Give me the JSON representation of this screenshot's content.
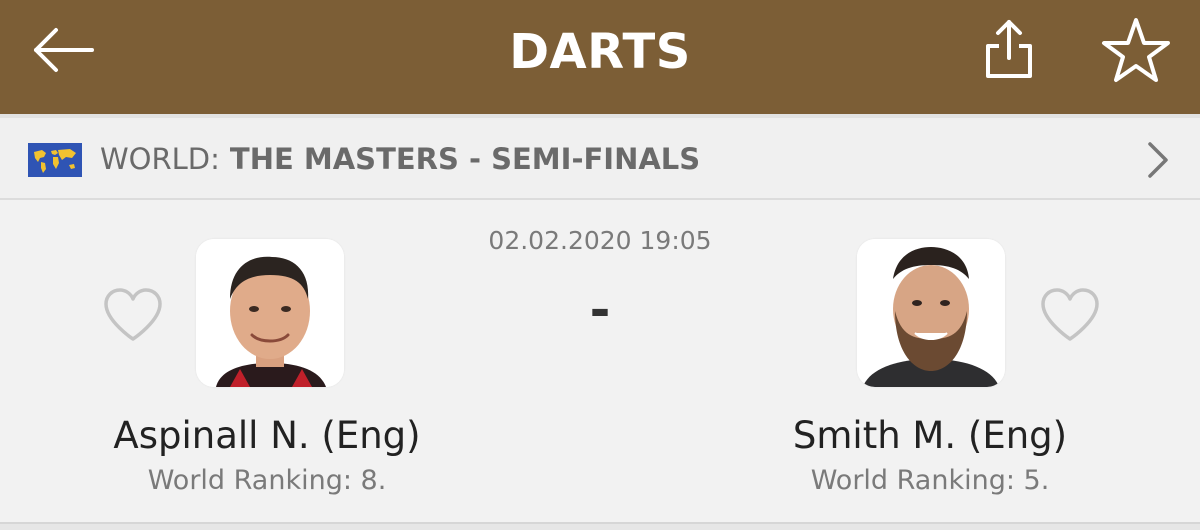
{
  "header": {
    "title": "DARTS",
    "back_icon": "arrow-left-icon",
    "share_icon": "share-icon",
    "favorite_icon": "star-icon",
    "background_color": "#7c5e36"
  },
  "league": {
    "flag_icon": "world-map-flag-icon",
    "country": "WORLD:",
    "name": "THE MASTERS - SEMI-FINALS",
    "chevron_icon": "chevron-right-icon"
  },
  "match": {
    "datetime": "02.02.2020 19:05",
    "score": "-",
    "home": {
      "name": "Aspinall N. (Eng)",
      "ranking": "World Ranking: 8.",
      "favorite_icon": "heart-icon"
    },
    "away": {
      "name": "Smith M. (Eng)",
      "ranking": "World Ranking: 5.",
      "favorite_icon": "heart-icon"
    }
  }
}
